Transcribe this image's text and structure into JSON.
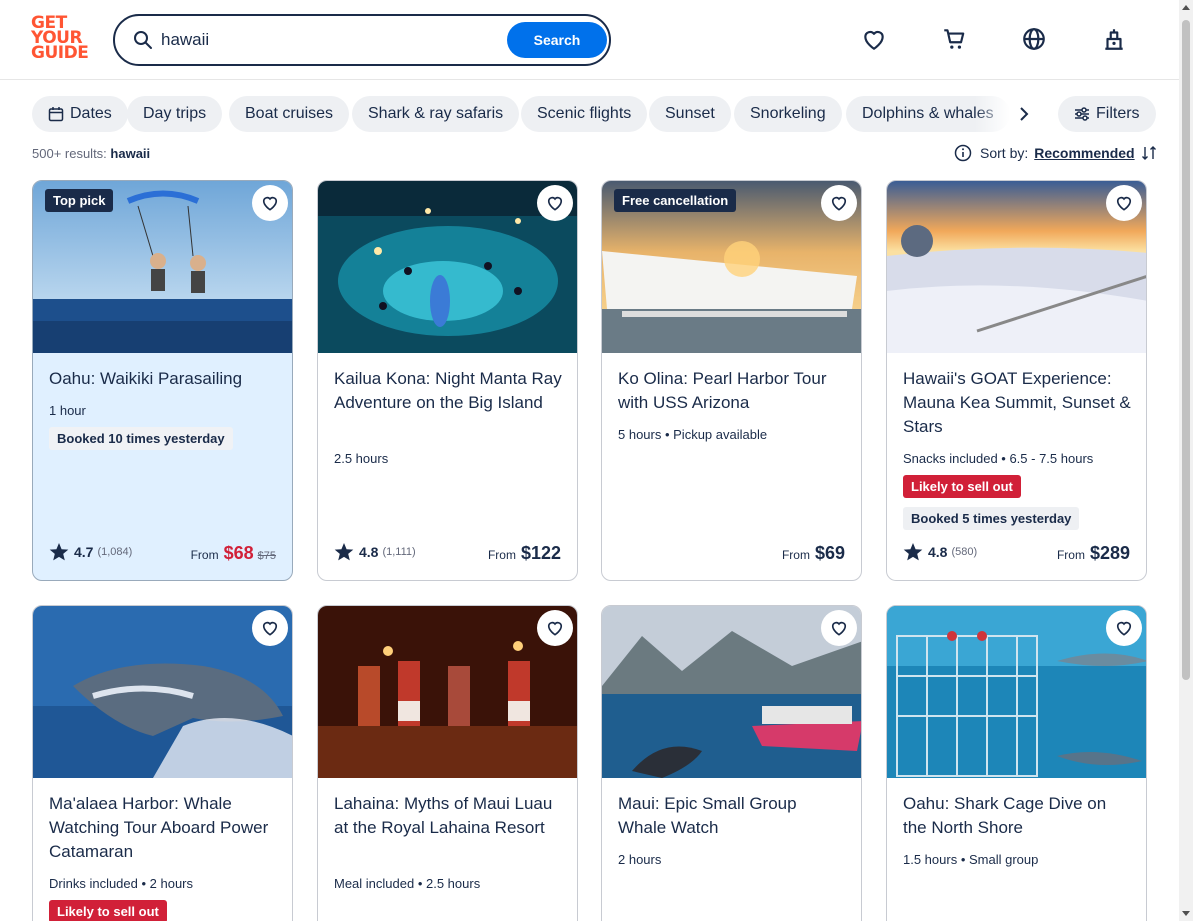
{
  "brand": {
    "line1": "GET",
    "line2": "YOUR",
    "line3": "GUIDE"
  },
  "search": {
    "value": "hawaii",
    "button": "Search"
  },
  "chips": [
    "Dates",
    "Day trips",
    "Boat cruises",
    "Shark & ray safaris",
    "Scenic flights",
    "Sunset",
    "Snorkeling",
    "Dolphins & whales"
  ],
  "filters_label": "Filters",
  "results": {
    "count": "500+ results:",
    "query": "hawaii"
  },
  "sort": {
    "label": "Sort by:",
    "value": "Recommended"
  },
  "cards": [
    {
      "badge": "Top pick",
      "title": "Oahu: Waikiki Parasailing",
      "meta": "1 hour",
      "booked": "Booked 10 times yesterday",
      "rating": "4.7",
      "reviews": "(1,084)",
      "from": "From",
      "price": "$68",
      "old_price": "$75"
    },
    {
      "title": "Kailua Kona: Night Manta Ray Adventure on the Big Island",
      "meta": "2.5 hours",
      "rating": "4.8",
      "reviews": "(1,111)",
      "from": "From",
      "price": "$122"
    },
    {
      "badge": "Free cancellation",
      "title": "Ko Olina: Pearl Harbor Tour with USS Arizona",
      "meta": "5 hours • Pickup available",
      "from": "From",
      "price": "$69"
    },
    {
      "title": "Hawaii's GOAT Experience: Mauna Kea Summit, Sunset & Stars",
      "meta": "Snacks included • 6.5 - 7.5 hours",
      "sell": "Likely to sell out",
      "booked": "Booked 5 times yesterday",
      "rating": "4.8",
      "reviews": "(580)",
      "from": "From",
      "price": "$289"
    },
    {
      "title": "Ma'alaea Harbor: Whale Watching Tour Aboard Power Catamaran",
      "meta": "Drinks included • 2 hours",
      "sell": "Likely to sell out"
    },
    {
      "title": "Lahaina: Myths of Maui Luau at the Royal Lahaina Resort",
      "meta": "Meal included • 2.5 hours"
    },
    {
      "title": "Maui: Epic Small Group Whale Watch",
      "meta": "2 hours"
    },
    {
      "title": "Oahu: Shark Cage Dive on the North Shore",
      "meta": "1.5 hours • Small group"
    }
  ],
  "colors": {
    "brand": "#ff5533",
    "primary": "#0071eb",
    "navy": "#1a2b49",
    "sale": "#d12038",
    "highlight": "#e0f0ff"
  }
}
